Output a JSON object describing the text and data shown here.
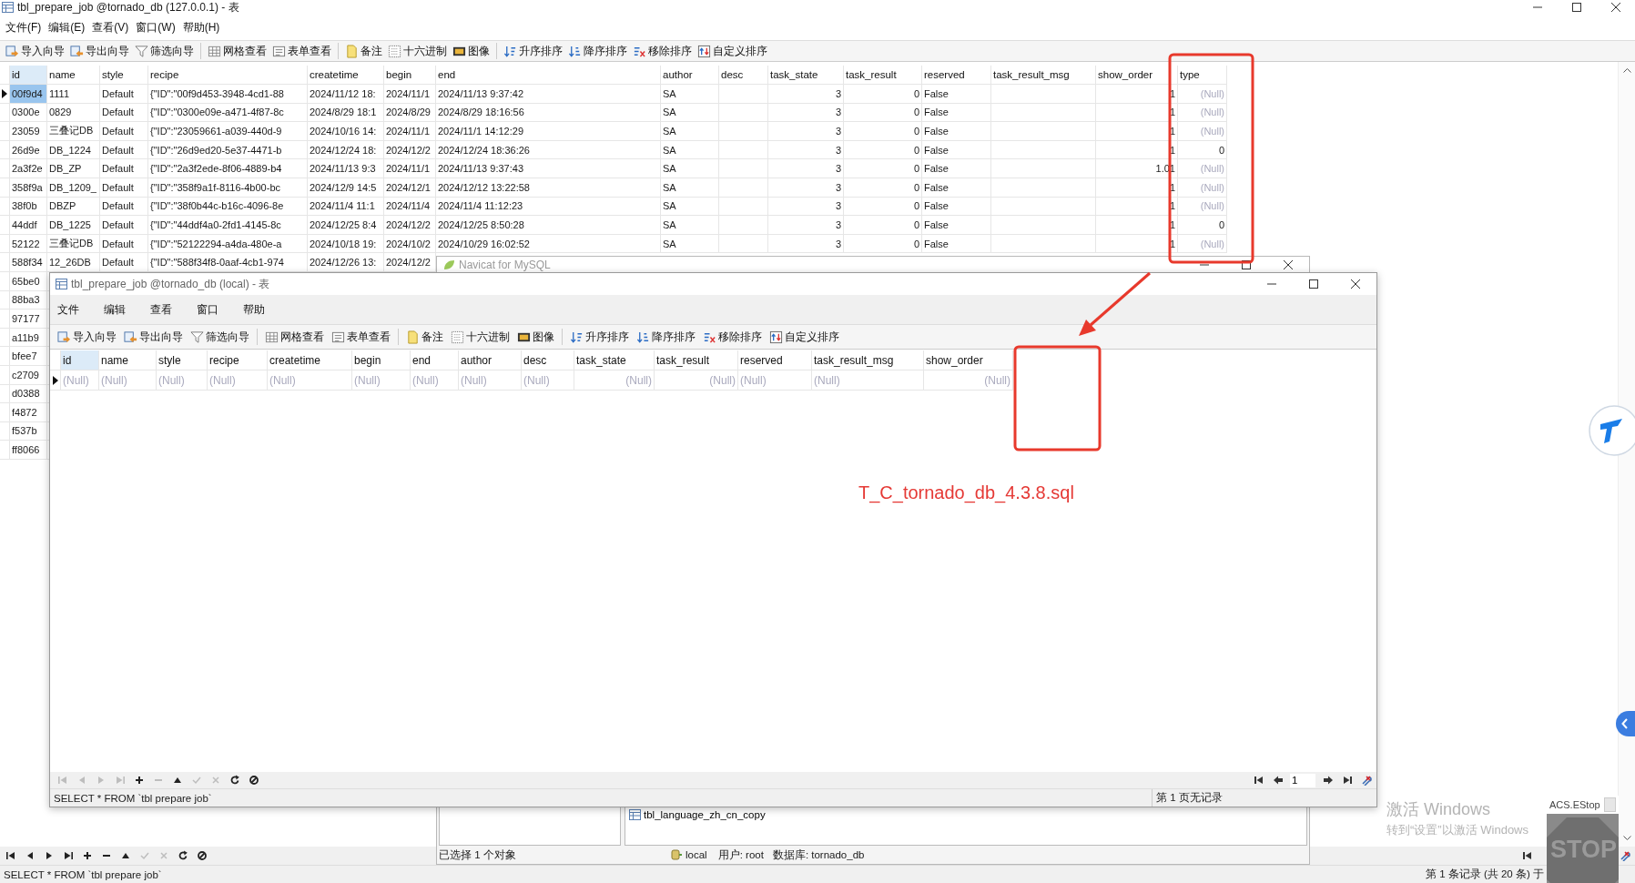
{
  "back_window": {
    "title": "tbl_prepare_job @tornado_db (127.0.0.1) - 表",
    "menu": [
      "文件(F)",
      "编辑(E)",
      "查看(V)",
      "窗口(W)",
      "帮助(H)"
    ],
    "toolbar": [
      [
        "导入向导",
        "导出向导",
        "筛选向导"
      ],
      [
        "网格查看",
        "表单查看"
      ],
      [
        "备注",
        "十六进制",
        "图像"
      ],
      [
        "升序排序",
        "降序排序",
        "移除排序",
        "自定义排序"
      ]
    ],
    "table": {
      "columns": [
        {
          "label": "id",
          "selected": true
        },
        {
          "label": "name",
          "selected": false
        },
        {
          "label": "style",
          "selected": false
        },
        {
          "label": "recipe",
          "selected": false
        },
        {
          "label": "createtime",
          "selected": false
        },
        {
          "label": "begin",
          "selected": false
        },
        {
          "label": "end",
          "selected": false
        },
        {
          "label": "author",
          "selected": false
        },
        {
          "label": "desc",
          "selected": false
        },
        {
          "label": "task_state",
          "selected": false
        },
        {
          "label": "task_result",
          "selected": false
        },
        {
          "label": "reserved",
          "selected": false
        },
        {
          "label": "task_result_msg",
          "selected": false
        },
        {
          "label": "show_order",
          "selected": false
        },
        {
          "label": "type",
          "selected": false
        }
      ],
      "rows": [
        {
          "selected": true,
          "cells": [
            {
              "text": "00f9d4",
              "focused": true
            },
            "1111",
            "Default",
            "{\"ID\":\"00f9d453-3948-4cd1-88",
            "2024/11/12 18:",
            "2024/11/1",
            "2024/11/13 9:37:42",
            "SA",
            null,
            "3",
            "0",
            "False",
            null,
            "1",
            {
              "text": "(Null)",
              "kind": "null"
            }
          ]
        },
        {
          "selected": false,
          "cells": [
            "0300e",
            "0829",
            "Default",
            "{\"ID\":\"0300e09e-a471-4f87-8c",
            "2024/8/29 18:1",
            "2024/8/29",
            "2024/8/29 18:16:56",
            "SA",
            null,
            "3",
            "0",
            "False",
            null,
            "1",
            {
              "text": "(Null)",
              "kind": "null"
            }
          ]
        },
        {
          "selected": false,
          "cells": [
            "23059",
            "三叠记DB",
            "Default",
            "{\"ID\":\"23059661-a039-440d-9",
            "2024/10/16 14:",
            "2024/11/1",
            "2024/11/1 14:12:29",
            "SA",
            null,
            "3",
            "0",
            "False",
            null,
            "1",
            {
              "text": "(Null)",
              "kind": "null"
            }
          ]
        },
        {
          "selected": false,
          "cells": [
            "26d9e",
            "DB_1224",
            "Default",
            "{\"ID\":\"26d9ed20-5e37-4471-b",
            "2024/12/24 18:",
            "2024/12/2",
            "2024/12/24 18:36:26",
            "SA",
            null,
            "3",
            "0",
            "False",
            null,
            "1",
            "0"
          ]
        },
        {
          "selected": false,
          "cells": [
            "2a3f2e",
            "DB_ZP",
            "Default",
            "{\"ID\":\"2a3f2ede-8f06-4889-b4",
            "2024/11/13 9:3",
            "2024/11/1",
            "2024/11/13 9:37:43",
            "SA",
            null,
            "3",
            "0",
            "False",
            null,
            "1.01",
            {
              "text": "(Null)",
              "kind": "null"
            }
          ]
        },
        {
          "selected": false,
          "cells": [
            "358f9a",
            "DB_1209_",
            "Default",
            "{\"ID\":\"358f9a1f-8116-4b00-bc",
            "2024/12/9 14:5",
            "2024/12/1",
            "2024/12/12 13:22:58",
            "SA",
            null,
            "3",
            "0",
            "False",
            null,
            "1",
            {
              "text": "(Null)",
              "kind": "null"
            }
          ]
        },
        {
          "selected": false,
          "cells": [
            "38f0b",
            "DBZP",
            "Default",
            "{\"ID\":\"38f0b44c-b16c-4096-8e",
            "2024/11/4 11:1",
            "2024/11/4",
            "2024/11/4 11:12:23",
            "SA",
            null,
            "3",
            "0",
            "False",
            null,
            "1",
            {
              "text": "(Null)",
              "kind": "null"
            }
          ]
        },
        {
          "selected": false,
          "cells": [
            "44ddf",
            "DB_1225",
            "Default",
            "{\"ID\":\"44ddf4a0-2fd1-4145-8c",
            "2024/12/25 8:4",
            "2024/12/2",
            "2024/12/25 8:50:28",
            "SA",
            null,
            "3",
            "0",
            "False",
            null,
            "1",
            "0"
          ]
        },
        {
          "selected": false,
          "cells": [
            "52122",
            "三叠记DB",
            "Default",
            "{\"ID\":\"52122294-a4da-480e-a",
            "2024/10/18 19:",
            "2024/10/2",
            "2024/10/29 16:02:52",
            "SA",
            null,
            "3",
            "0",
            "False",
            null,
            "1",
            {
              "text": "(Null)",
              "kind": "null"
            }
          ]
        },
        {
          "selected": false,
          "cells": [
            "588f34",
            "12_26DB",
            "Default",
            "{\"ID\":\"588f34f8-0aaf-4cb1-974",
            "2024/12/26 13:",
            "2024/12/2"
          ]
        },
        {
          "selected": false,
          "cells": [
            "65be0"
          ]
        },
        {
          "selected": false,
          "cells": [
            "88ba3"
          ]
        },
        {
          "selected": false,
          "cells": [
            "97177"
          ]
        },
        {
          "selected": false,
          "cells": [
            "a11b9"
          ]
        },
        {
          "selected": false,
          "cells": [
            "bfee7"
          ]
        },
        {
          "selected": false,
          "cells": [
            "c2709"
          ]
        },
        {
          "selected": false,
          "cells": [
            "d0388"
          ]
        },
        {
          "selected": false,
          "cells": [
            "f4872"
          ]
        },
        {
          "selected": false,
          "cells": [
            "f537b"
          ]
        },
        {
          "selected": false,
          "cells": [
            "ff8066"
          ]
        }
      ]
    },
    "navigator": [
      {
        "disabled": false
      },
      {
        "disabled": false
      },
      {
        "disabled": false
      },
      {
        "disabled": false
      },
      {
        "disabled": false
      },
      {
        "disabled": false
      },
      {
        "disabled": false
      },
      {
        "disabled": true
      },
      {
        "disabled": true
      },
      {
        "disabled": false
      },
      {
        "disabled": false
      }
    ],
    "status_query": "SELECT * FROM `tbl prepare job`",
    "status_records": "第 1 条记录 (共 20 条) 于"
  },
  "navicat_window": {
    "title": "Navicat for MySQL",
    "object_item": "tbl_language_zh_cn_copy",
    "selection": "已选择 1 个对象",
    "connection": "local",
    "user": "用户: root",
    "database": "数据库: tornado_db"
  },
  "front_window": {
    "title": "tbl_prepare_job @tornado_db (local) - 表",
    "menu": [
      "文件",
      "编辑",
      "查看",
      "窗口",
      "帮助"
    ],
    "toolbar": [
      [
        "导入向导",
        "导出向导",
        "筛选向导"
      ],
      [
        "网格查看",
        "表单查看"
      ],
      [
        "备注",
        "十六进制",
        "图像"
      ],
      [
        "升序排序",
        "降序排序",
        "移除排序",
        "自定义排序"
      ]
    ],
    "table": {
      "columns": [
        {
          "label": "id",
          "selected": true
        },
        {
          "label": "name",
          "selected": false
        },
        {
          "label": "style",
          "selected": false
        },
        {
          "label": "recipe",
          "selected": false
        },
        {
          "label": "createtime",
          "selected": false
        },
        {
          "label": "begin",
          "selected": false
        },
        {
          "label": "end",
          "selected": false
        },
        {
          "label": "author",
          "selected": false
        },
        {
          "label": "desc",
          "selected": false
        },
        {
          "label": "task_state",
          "selected": false
        },
        {
          "label": "task_result",
          "selected": false
        },
        {
          "label": "reserved",
          "selected": false
        },
        {
          "label": "task_result_msg",
          "selected": false
        },
        {
          "label": "show_order",
          "selected": false
        }
      ],
      "rows": [
        {
          "selected": true,
          "cells": [
            {
              "text": "(Null)",
              "kind": "null"
            },
            {
              "text": "(Null)",
              "kind": "null"
            },
            {
              "text": "(Null)",
              "kind": "null"
            },
            {
              "text": "(Null)",
              "kind": "null"
            },
            {
              "text": "(Null)",
              "kind": "null"
            },
            {
              "text": "(Null)",
              "kind": "null"
            },
            {
              "text": "(Null)",
              "kind": "null"
            },
            {
              "text": "(Null)",
              "kind": "null"
            },
            {
              "text": "(Null)",
              "kind": "null"
            },
            {
              "text": "(Null)",
              "kind": "null"
            },
            {
              "text": "(Null)",
              "kind": "null"
            },
            {
              "text": "(Null)",
              "kind": "null"
            },
            {
              "text": "(Null)",
              "kind": "null"
            },
            {
              "text": "(Null)",
              "kind": "null"
            }
          ]
        }
      ]
    },
    "navigator": [
      {
        "disabled": true
      },
      {
        "disabled": true
      },
      {
        "disabled": true
      },
      {
        "disabled": true
      },
      {
        "disabled": false
      },
      {
        "disabled": true
      },
      {
        "disabled": false
      },
      {
        "disabled": true
      },
      {
        "disabled": true
      },
      {
        "disabled": false
      },
      {
        "disabled": false
      }
    ],
    "page": "1",
    "status_query": "SELECT * FROM `tbl prepare job`",
    "status_page": "第 1 页无记录"
  },
  "annotation": {
    "label": "T_C_tornado_db_4.3.8.sql"
  },
  "activation_notice": {
    "title": "激活 Windows",
    "hint": "转到“设置”以激活 Windows"
  },
  "estop_widget": {
    "title": "ACS.EStop",
    "checked": false,
    "sign": "STOP"
  }
}
